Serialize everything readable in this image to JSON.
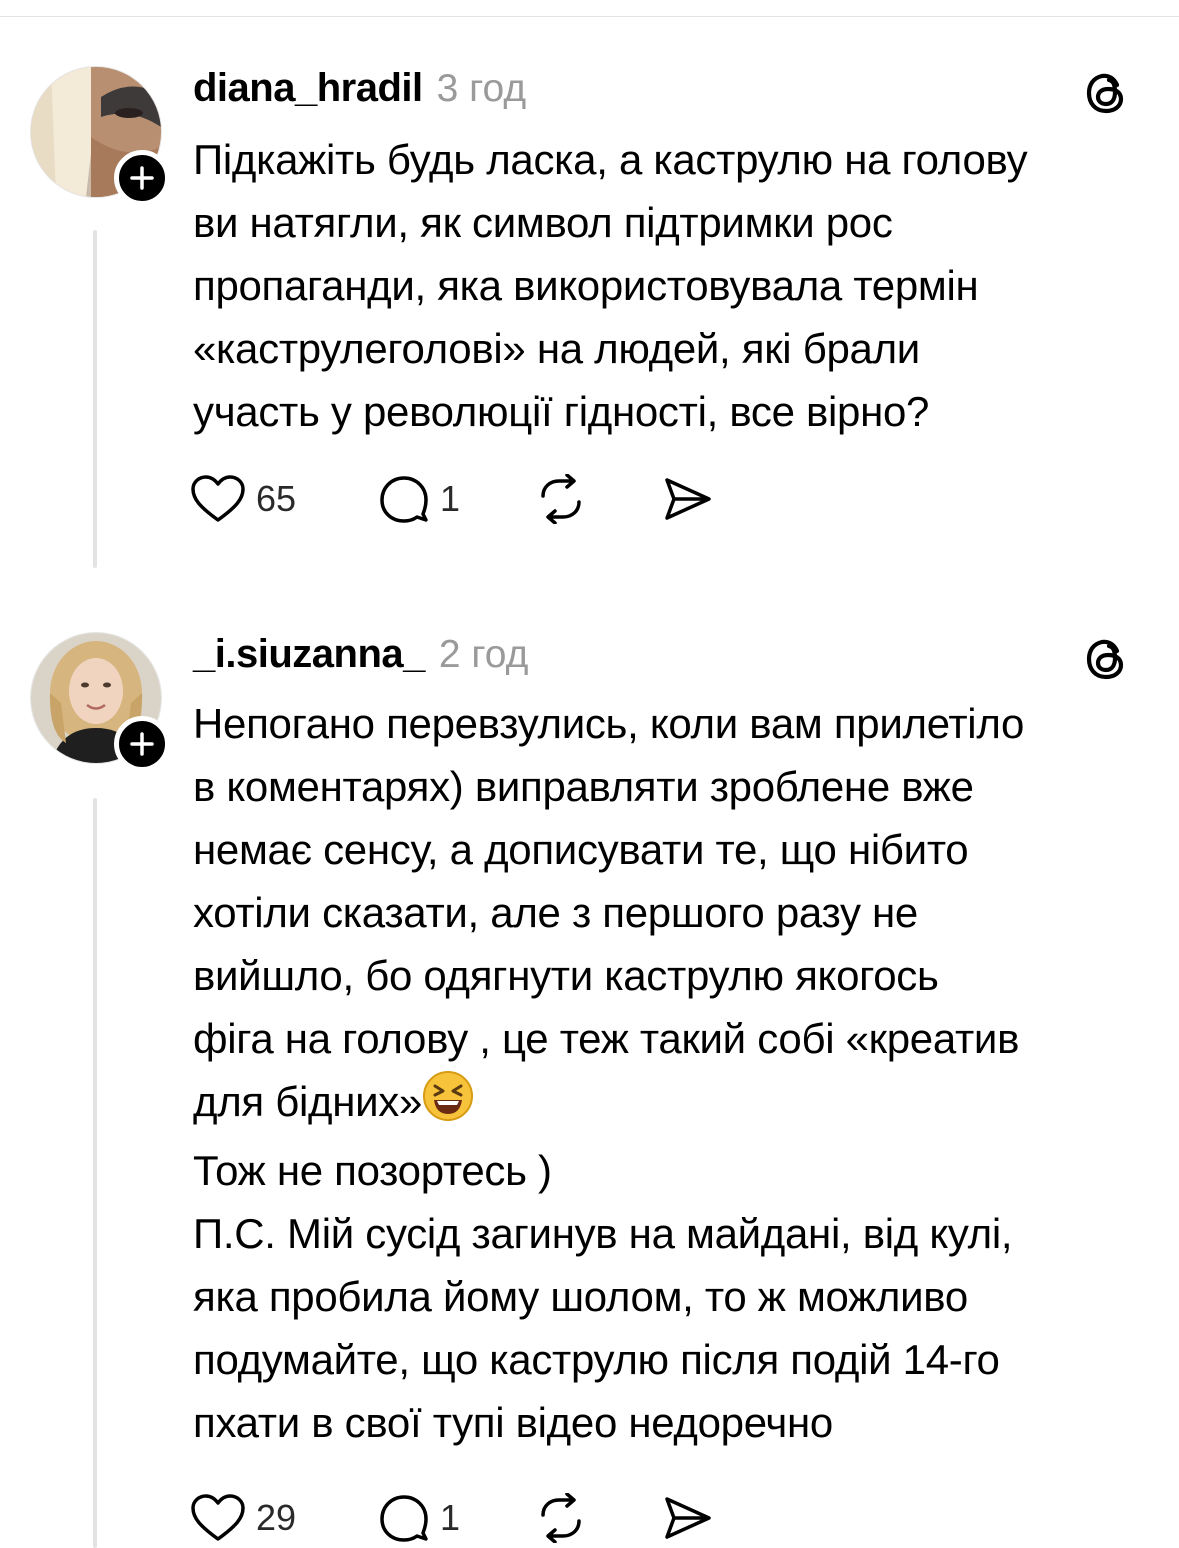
{
  "posts": [
    {
      "username": "diana_hradil",
      "time": "3 год",
      "text_lines": [
        "Підкажіть будь ласка, а каструлю на голову",
        "ви натягли, як символ підтримки рос",
        "пропаганди, яка використовувала термін",
        "«каструлеголові» на людей, які брали",
        "участь у революції гідності,  все вірно?"
      ],
      "likes": "65",
      "replies": "1"
    },
    {
      "username": "_i.siuzanna_",
      "time": "2 год",
      "text_lines": [
        "Непогано перевзулись, коли вам прилетіло",
        "в коментарях) виправляти зроблене вже",
        "немає сенсу, а дописувати те, що нібито",
        "хотіли сказати, але з першого разу не",
        "вийшло, бо  одягнути каструлю якогось",
        "фіга на голову , це теж такий собі «креатив",
        "для бідних»"
      ],
      "text_emoji": "😆",
      "text_para2": "Тож не позортесь )",
      "text_para3_lines": [
        "П.С. Мій сусід загинув на майдані, від кулі,",
        "яка пробила йому шолом, то ж можливо",
        "подумайте, що каструлю після подій 14-го",
        "пхати в свої тупі відео недоречно"
      ],
      "likes": "29",
      "replies": "1"
    }
  ],
  "icons": {
    "like": "heart-icon",
    "reply": "comment-icon",
    "repost": "repost-icon",
    "share": "send-icon",
    "brand": "threads-logo-icon",
    "follow": "plus-icon"
  }
}
